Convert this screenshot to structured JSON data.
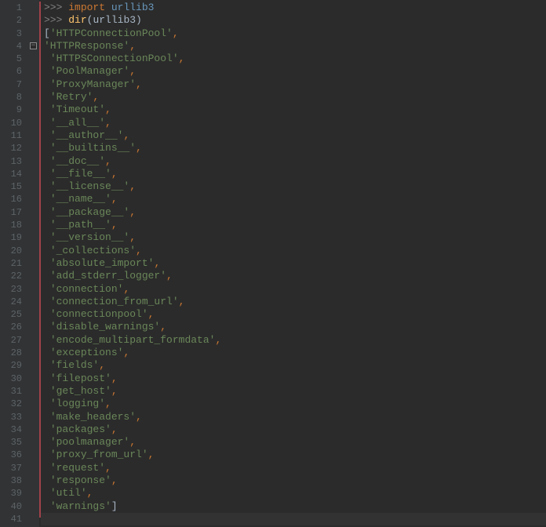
{
  "lines": [
    [
      {
        "c": "tok-prompt",
        "t": ">>> "
      },
      {
        "c": "tok-keyword",
        "t": "import"
      },
      {
        "c": "tok-ident",
        "t": " "
      },
      {
        "c": "tok-module",
        "t": "urllib3"
      }
    ],
    [
      {
        "c": "tok-prompt",
        "t": ">>> "
      },
      {
        "c": "tok-func",
        "t": "dir"
      },
      {
        "c": "tok-paren",
        "t": "("
      },
      {
        "c": "tok-ident",
        "t": "urllib3"
      },
      {
        "c": "tok-paren",
        "t": ")"
      }
    ],
    [
      {
        "c": "tok-open",
        "t": "["
      },
      {
        "c": "tok-str",
        "t": "'HTTPConnectionPool'"
      },
      {
        "c": "tok-punct",
        "t": ","
      }
    ],
    [
      {
        "c": "tok-str",
        "t": "'HTTPResponse'"
      },
      {
        "c": "tok-punct",
        "t": ","
      }
    ],
    [
      {
        "c": "tok-ident",
        "t": " "
      },
      {
        "c": "tok-str",
        "t": "'HTTPSConnectionPool'"
      },
      {
        "c": "tok-punct",
        "t": ","
      }
    ],
    [
      {
        "c": "tok-ident",
        "t": " "
      },
      {
        "c": "tok-str",
        "t": "'PoolManager'"
      },
      {
        "c": "tok-punct",
        "t": ","
      }
    ],
    [
      {
        "c": "tok-ident",
        "t": " "
      },
      {
        "c": "tok-str",
        "t": "'ProxyManager'"
      },
      {
        "c": "tok-punct",
        "t": ","
      }
    ],
    [
      {
        "c": "tok-ident",
        "t": " "
      },
      {
        "c": "tok-str",
        "t": "'Retry'"
      },
      {
        "c": "tok-punct",
        "t": ","
      }
    ],
    [
      {
        "c": "tok-ident",
        "t": " "
      },
      {
        "c": "tok-str",
        "t": "'Timeout'"
      },
      {
        "c": "tok-punct",
        "t": ","
      }
    ],
    [
      {
        "c": "tok-ident",
        "t": " "
      },
      {
        "c": "tok-str",
        "t": "'__all__'"
      },
      {
        "c": "tok-punct",
        "t": ","
      }
    ],
    [
      {
        "c": "tok-ident",
        "t": " "
      },
      {
        "c": "tok-str",
        "t": "'__author__'"
      },
      {
        "c": "tok-punct",
        "t": ","
      }
    ],
    [
      {
        "c": "tok-ident",
        "t": " "
      },
      {
        "c": "tok-str",
        "t": "'__builtins__'"
      },
      {
        "c": "tok-punct",
        "t": ","
      }
    ],
    [
      {
        "c": "tok-ident",
        "t": " "
      },
      {
        "c": "tok-str",
        "t": "'__doc__'"
      },
      {
        "c": "tok-punct",
        "t": ","
      }
    ],
    [
      {
        "c": "tok-ident",
        "t": " "
      },
      {
        "c": "tok-str",
        "t": "'__file__'"
      },
      {
        "c": "tok-punct",
        "t": ","
      }
    ],
    [
      {
        "c": "tok-ident",
        "t": " "
      },
      {
        "c": "tok-str",
        "t": "'__license__'"
      },
      {
        "c": "tok-punct",
        "t": ","
      }
    ],
    [
      {
        "c": "tok-ident",
        "t": " "
      },
      {
        "c": "tok-str",
        "t": "'__name__'"
      },
      {
        "c": "tok-punct",
        "t": ","
      }
    ],
    [
      {
        "c": "tok-ident",
        "t": " "
      },
      {
        "c": "tok-str",
        "t": "'__package__'"
      },
      {
        "c": "tok-punct",
        "t": ","
      }
    ],
    [
      {
        "c": "tok-ident",
        "t": " "
      },
      {
        "c": "tok-str",
        "t": "'__path__'"
      },
      {
        "c": "tok-punct",
        "t": ","
      }
    ],
    [
      {
        "c": "tok-ident",
        "t": " "
      },
      {
        "c": "tok-str",
        "t": "'__version__'"
      },
      {
        "c": "tok-punct",
        "t": ","
      }
    ],
    [
      {
        "c": "tok-ident",
        "t": " "
      },
      {
        "c": "tok-str",
        "t": "'_collections'"
      },
      {
        "c": "tok-punct",
        "t": ","
      }
    ],
    [
      {
        "c": "tok-ident",
        "t": " "
      },
      {
        "c": "tok-str",
        "t": "'absolute_import'"
      },
      {
        "c": "tok-punct",
        "t": ","
      }
    ],
    [
      {
        "c": "tok-ident",
        "t": " "
      },
      {
        "c": "tok-str",
        "t": "'add_stderr_logger'"
      },
      {
        "c": "tok-punct",
        "t": ","
      }
    ],
    [
      {
        "c": "tok-ident",
        "t": " "
      },
      {
        "c": "tok-str",
        "t": "'connection'"
      },
      {
        "c": "tok-punct",
        "t": ","
      }
    ],
    [
      {
        "c": "tok-ident",
        "t": " "
      },
      {
        "c": "tok-str",
        "t": "'connection_from_url'"
      },
      {
        "c": "tok-punct",
        "t": ","
      }
    ],
    [
      {
        "c": "tok-ident",
        "t": " "
      },
      {
        "c": "tok-str",
        "t": "'connectionpool'"
      },
      {
        "c": "tok-punct",
        "t": ","
      }
    ],
    [
      {
        "c": "tok-ident",
        "t": " "
      },
      {
        "c": "tok-str",
        "t": "'disable_warnings'"
      },
      {
        "c": "tok-punct",
        "t": ","
      }
    ],
    [
      {
        "c": "tok-ident",
        "t": " "
      },
      {
        "c": "tok-str",
        "t": "'encode_multipart_formdata'"
      },
      {
        "c": "tok-punct",
        "t": ","
      }
    ],
    [
      {
        "c": "tok-ident",
        "t": " "
      },
      {
        "c": "tok-str",
        "t": "'exceptions'"
      },
      {
        "c": "tok-punct",
        "t": ","
      }
    ],
    [
      {
        "c": "tok-ident",
        "t": " "
      },
      {
        "c": "tok-str",
        "t": "'fields'"
      },
      {
        "c": "tok-punct",
        "t": ","
      }
    ],
    [
      {
        "c": "tok-ident",
        "t": " "
      },
      {
        "c": "tok-str",
        "t": "'filepost'"
      },
      {
        "c": "tok-punct",
        "t": ","
      }
    ],
    [
      {
        "c": "tok-ident",
        "t": " "
      },
      {
        "c": "tok-str",
        "t": "'get_host'"
      },
      {
        "c": "tok-punct",
        "t": ","
      }
    ],
    [
      {
        "c": "tok-ident",
        "t": " "
      },
      {
        "c": "tok-str",
        "t": "'logging'"
      },
      {
        "c": "tok-punct",
        "t": ","
      }
    ],
    [
      {
        "c": "tok-ident",
        "t": " "
      },
      {
        "c": "tok-str",
        "t": "'make_headers'"
      },
      {
        "c": "tok-punct",
        "t": ","
      }
    ],
    [
      {
        "c": "tok-ident",
        "t": " "
      },
      {
        "c": "tok-str",
        "t": "'packages'"
      },
      {
        "c": "tok-punct",
        "t": ","
      }
    ],
    [
      {
        "c": "tok-ident",
        "t": " "
      },
      {
        "c": "tok-str",
        "t": "'poolmanager'"
      },
      {
        "c": "tok-punct",
        "t": ","
      }
    ],
    [
      {
        "c": "tok-ident",
        "t": " "
      },
      {
        "c": "tok-str",
        "t": "'proxy_from_url'"
      },
      {
        "c": "tok-punct",
        "t": ","
      }
    ],
    [
      {
        "c": "tok-ident",
        "t": " "
      },
      {
        "c": "tok-str",
        "t": "'request'"
      },
      {
        "c": "tok-punct",
        "t": ","
      }
    ],
    [
      {
        "c": "tok-ident",
        "t": " "
      },
      {
        "c": "tok-str",
        "t": "'response'"
      },
      {
        "c": "tok-punct",
        "t": ","
      }
    ],
    [
      {
        "c": "tok-ident",
        "t": " "
      },
      {
        "c": "tok-str",
        "t": "'util'"
      },
      {
        "c": "tok-punct",
        "t": ","
      }
    ],
    [
      {
        "c": "tok-ident",
        "t": " "
      },
      {
        "c": "tok-str",
        "t": "'warnings'"
      },
      {
        "c": "tok-open",
        "t": "]"
      }
    ],
    []
  ],
  "fold_line": 4,
  "line_count": 41
}
